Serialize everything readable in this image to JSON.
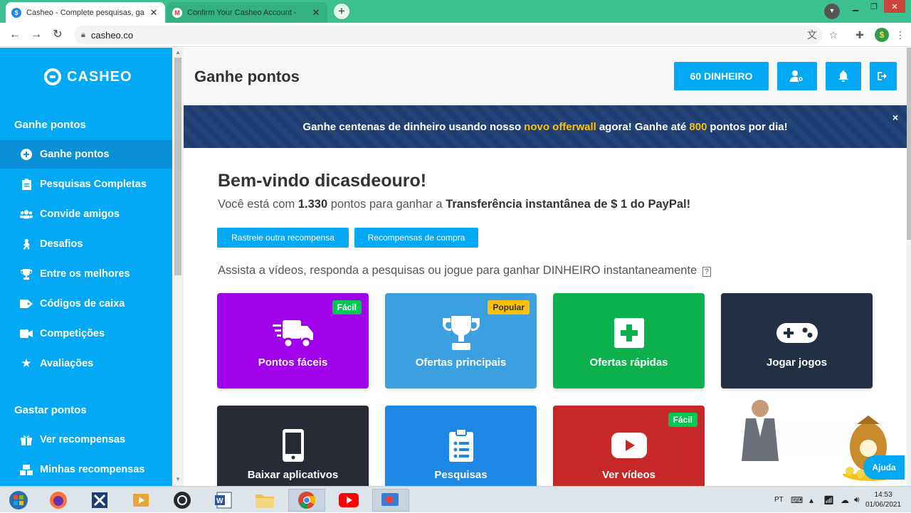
{
  "browser": {
    "tabs": [
      {
        "title": "Casheo - Complete pesquisas, ga",
        "active": true
      },
      {
        "title": "Confirm Your Casheo Account - ",
        "active": false
      }
    ],
    "new_tab": "+",
    "url": "casheo.co"
  },
  "sidebar": {
    "logo": "CASHEO",
    "section1_title": "Ganhe pontos",
    "section1_items": [
      {
        "label": "Ganhe pontos",
        "icon": "plus-circle-icon",
        "active": true
      },
      {
        "label": "Pesquisas Completas",
        "icon": "clipboard-icon"
      },
      {
        "label": "Convide amigos",
        "icon": "users-icon"
      },
      {
        "label": "Desafios",
        "icon": "hiking-icon"
      },
      {
        "label": "Entre os melhores",
        "icon": "trophy-icon"
      },
      {
        "label": "Códigos de caixa",
        "icon": "ticket-icon"
      },
      {
        "label": "Competições",
        "icon": "video-icon"
      },
      {
        "label": "Avaliações",
        "icon": "star-icon"
      }
    ],
    "section2_title": "Gastar pontos",
    "section2_items": [
      {
        "label": "Ver recompensas",
        "icon": "gift-icon"
      },
      {
        "label": "Minhas recompensas",
        "icon": "boxes-icon"
      }
    ]
  },
  "header": {
    "title": "Ganhe pontos",
    "balance_button": "60 DINHEIRO"
  },
  "banner": {
    "part1": "Ganhe centenas de dinheiro usando nosso",
    "highlight1": "novo offerwall",
    "part2": "agora! Ganhe até",
    "highlight2": "800",
    "part3": "pontos por dia!",
    "close": "×"
  },
  "welcome": {
    "title": "Bem-vindo dicasdeouro!",
    "line_prefix": "Você está com",
    "points": "1.330",
    "line_mid": "pontos para ganhar a",
    "reward": "Transferência instantânea de $ 1 do PayPal!",
    "btn_track": "Rastreie outra recompensa",
    "btn_shop": "Recompensas de compra",
    "assist": "Assista a vídeos, responda a pesquisas ou jogue para ganhar DINHEIRO instantaneamente"
  },
  "tiles": [
    {
      "label": "Pontos fáceis",
      "badge": "Fácil",
      "color": "#a000ea",
      "badge_bg": "#00c853",
      "badge_fg": "#ffffff",
      "icon": "truck-fast-icon"
    },
    {
      "label": "Ofertas principais",
      "badge": "Popular",
      "color": "#3c9fe0",
      "badge_bg": "#ffc107",
      "badge_fg": "#333333",
      "icon": "trophy-icon"
    },
    {
      "label": "Ofertas rápidas",
      "badge": "",
      "color": "#0db14b",
      "icon": "plus-square-icon"
    },
    {
      "label": "Jogar jogos",
      "badge": "",
      "color": "#232f43",
      "icon": "gamepad-icon"
    },
    {
      "label": "Baixar aplicativos",
      "badge": "",
      "color": "#262b36",
      "icon": "mobile-icon"
    },
    {
      "label": "Pesquisas",
      "badge": "",
      "color": "#1e88e5",
      "icon": "clipboard-list-icon"
    },
    {
      "label": "Ver vídeos",
      "badge": "Fácil",
      "color": "#c62828",
      "badge_bg": "#00c853",
      "badge_fg": "#ffffff",
      "icon": "youtube-icon"
    }
  ],
  "help_button": "Ajuda",
  "taskbar": {
    "language": "PT",
    "time": "14:53",
    "date": "01/06/2021"
  },
  "colors": {
    "accent": "#03a9f4",
    "banner": "#1d3d73",
    "browser_frame": "#3cc08f"
  }
}
